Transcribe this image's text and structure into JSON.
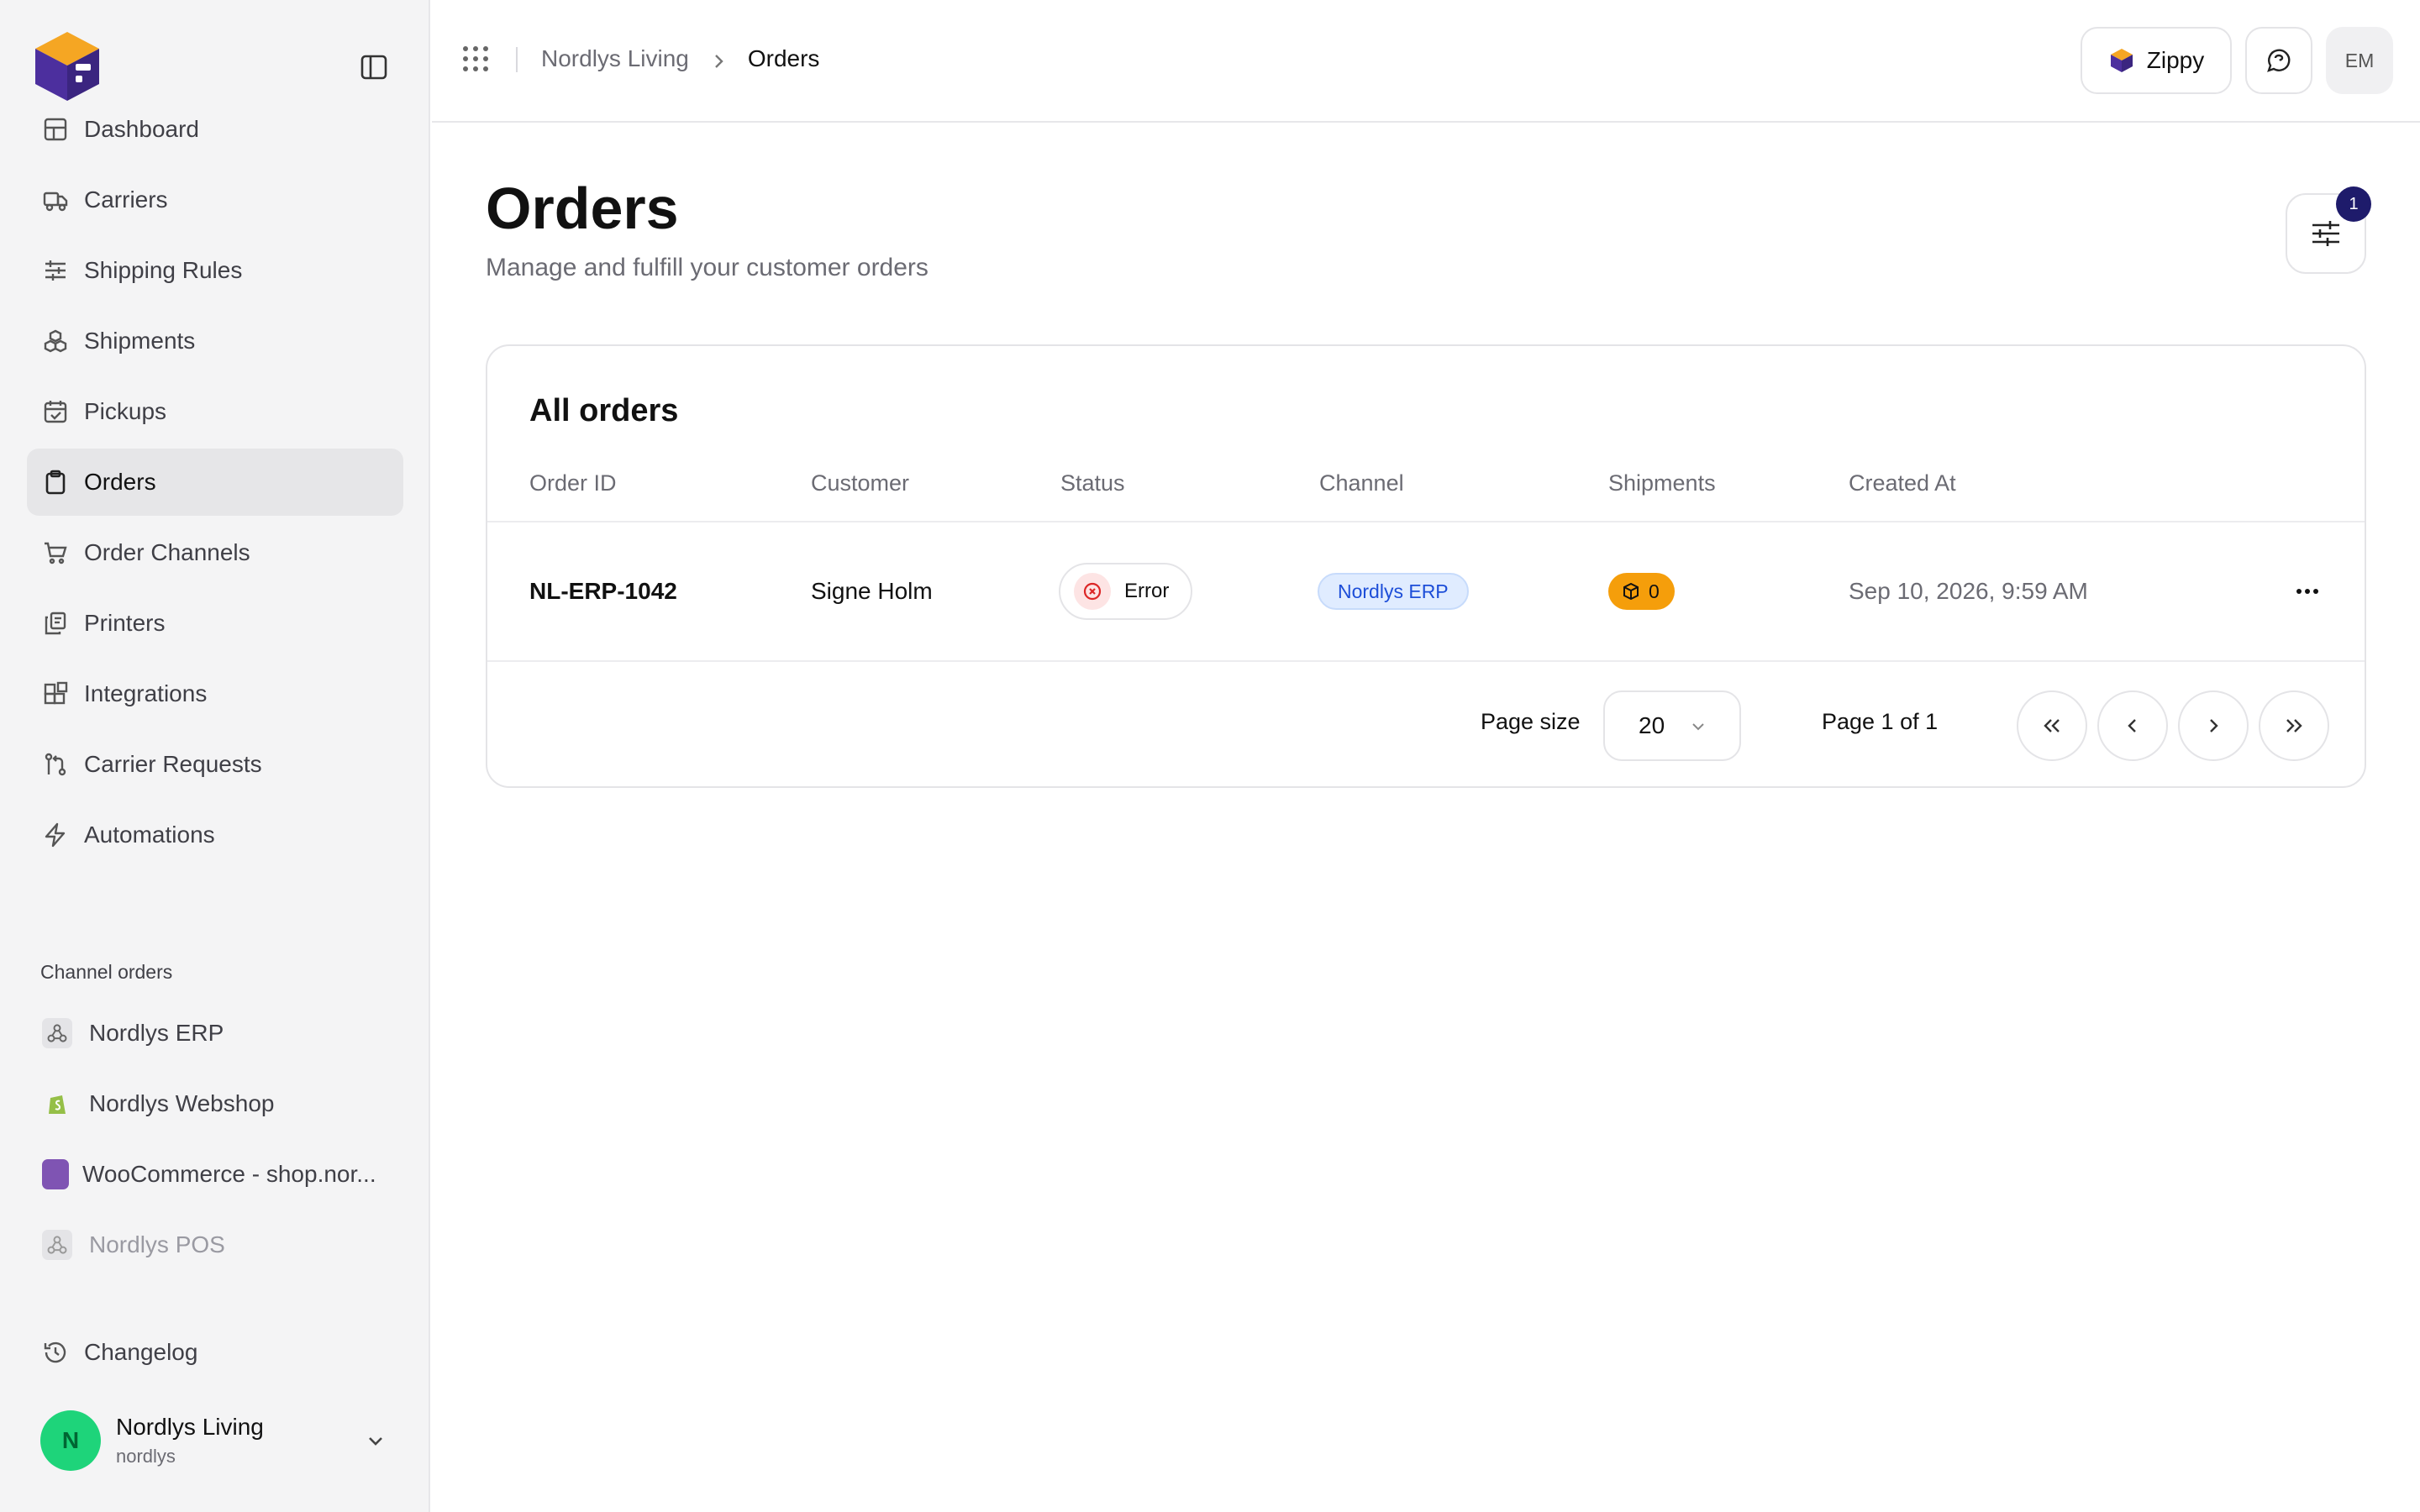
{
  "sidebar": {
    "nav": [
      {
        "label": "Dashboard",
        "icon": "dashboard-icon"
      },
      {
        "label": "Carriers",
        "icon": "truck-icon"
      },
      {
        "label": "Shipping Rules",
        "icon": "sliders-icon"
      },
      {
        "label": "Shipments",
        "icon": "boxes-icon"
      },
      {
        "label": "Pickups",
        "icon": "calendar-check-icon"
      },
      {
        "label": "Orders",
        "icon": "clipboard-icon",
        "active": true
      },
      {
        "label": "Order Channels",
        "icon": "cart-icon"
      },
      {
        "label": "Printers",
        "icon": "printer-copy-icon"
      },
      {
        "label": "Integrations",
        "icon": "blocks-icon"
      },
      {
        "label": "Carrier Requests",
        "icon": "git-pull-icon"
      },
      {
        "label": "Automations",
        "icon": "zap-icon"
      }
    ],
    "channels_section_label": "Channel orders",
    "channels": [
      {
        "label": "Nordlys ERP",
        "icon": "webhook-icon"
      },
      {
        "label": "Nordlys Webshop",
        "icon": "shopify-icon"
      },
      {
        "label": "WooCommerce - shop.nor...",
        "icon": "woocommerce-icon"
      },
      {
        "label": "Nordlys POS",
        "icon": "webhook-icon",
        "disabled": true
      }
    ],
    "changelog_label": "Changelog",
    "account": {
      "initial": "N",
      "name": "Nordlys Living",
      "handle": "nordlys"
    }
  },
  "topbar": {
    "breadcrumb_parent": "Nordlys Living",
    "breadcrumb_current": "Orders",
    "brand_label": "Zippy",
    "user_initials": "EM"
  },
  "main": {
    "title": "Orders",
    "subtitle": "Manage and fulfill your customer orders",
    "filter_count": "1",
    "card_title": "All orders",
    "columns": [
      "Order ID",
      "Customer",
      "Status",
      "Channel",
      "Shipments",
      "Created At"
    ],
    "rows": [
      {
        "order_id": "NL-ERP-1042",
        "customer": "Signe Holm",
        "status": "Error",
        "channel": "Nordlys ERP",
        "shipments": "0",
        "created_at": "Sep 10, 2026, 9:59 AM"
      }
    ],
    "pagination": {
      "page_size_label": "Page size",
      "page_size": "20",
      "page_info": "Page 1 of 1"
    }
  },
  "colors": {
    "accent": "#1e1b6b",
    "error": "#dc2626",
    "channel_badge": "#1d4ed8",
    "shipments_badge": "#f59e0b",
    "avatar": "#1ed47a"
  }
}
